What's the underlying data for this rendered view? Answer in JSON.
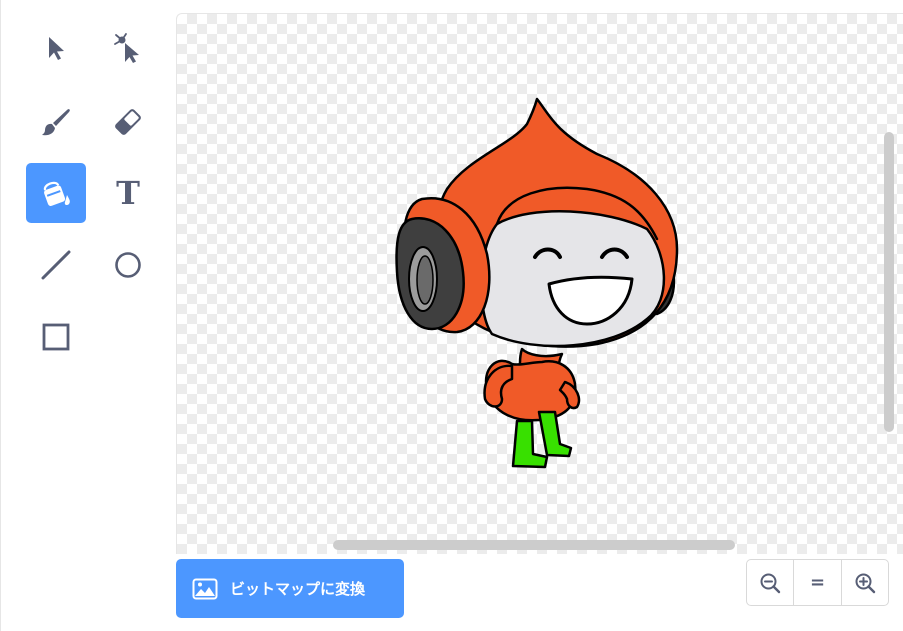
{
  "toolbar": {
    "tools": [
      {
        "name": "select",
        "icon": "select-arrow-icon",
        "selected": false
      },
      {
        "name": "reshape",
        "icon": "reshape-arrow-icon",
        "selected": false
      },
      {
        "name": "brush",
        "icon": "brush-icon",
        "selected": false
      },
      {
        "name": "eraser",
        "icon": "eraser-icon",
        "selected": false
      },
      {
        "name": "fill",
        "icon": "fill-bucket-icon",
        "selected": true
      },
      {
        "name": "text",
        "icon": "text-t-icon",
        "selected": false
      },
      {
        "name": "line",
        "icon": "line-icon",
        "selected": false
      },
      {
        "name": "circle",
        "icon": "circle-icon",
        "selected": false
      },
      {
        "name": "rectangle",
        "icon": "rectangle-icon",
        "selected": false
      }
    ],
    "text_tool_glyph": "T"
  },
  "canvas": {
    "content": "character-sprite",
    "background": "transparent-checkerboard"
  },
  "convert_button": {
    "label": "ビットマップに変換",
    "icon": "bitmap-image-icon"
  },
  "zoom": {
    "zoom_out_icon": "zoom-out-icon",
    "reset_label": "=",
    "zoom_in_icon": "zoom-in-icon"
  },
  "colors": {
    "accent": "#4c97ff",
    "icon": "#575e75",
    "sprite_orange": "#f05a28",
    "sprite_green": "#38e000",
    "sprite_face": "#e5e5e8"
  }
}
